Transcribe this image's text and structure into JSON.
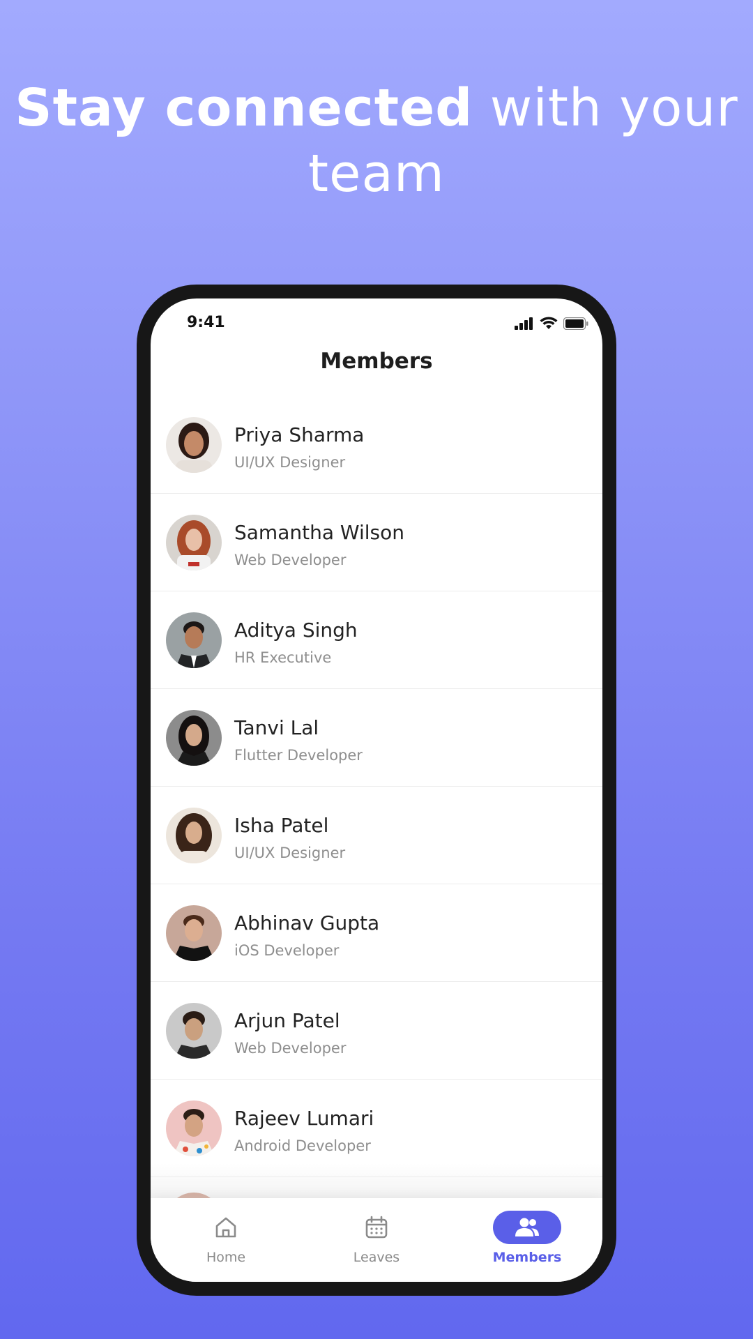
{
  "headline": {
    "bold": "Stay connected",
    "light": "with your team"
  },
  "status": {
    "time": "9:41"
  },
  "page": {
    "title": "Members"
  },
  "members": [
    {
      "name": "Priya Sharma",
      "role": "UI/UX Designer"
    },
    {
      "name": "Samantha Wilson",
      "role": "Web Developer"
    },
    {
      "name": "Aditya Singh",
      "role": "HR Executive"
    },
    {
      "name": "Tanvi Lal",
      "role": "Flutter Developer"
    },
    {
      "name": "Isha Patel",
      "role": "UI/UX Designer"
    },
    {
      "name": "Abhinav Gupta",
      "role": "iOS Developer"
    },
    {
      "name": "Arjun Patel",
      "role": "Web Developer"
    },
    {
      "name": "Rajeev Lumari",
      "role": "Android Developer"
    }
  ],
  "tabs": [
    {
      "label": "Home",
      "icon": "home-icon"
    },
    {
      "label": "Leaves",
      "icon": "calendar-icon"
    },
    {
      "label": "Members",
      "icon": "people-icon",
      "active": true
    }
  ],
  "colors": {
    "accent": "#5a5fe8",
    "background_top": "#a2aafe",
    "background_bottom": "#6168ef"
  }
}
